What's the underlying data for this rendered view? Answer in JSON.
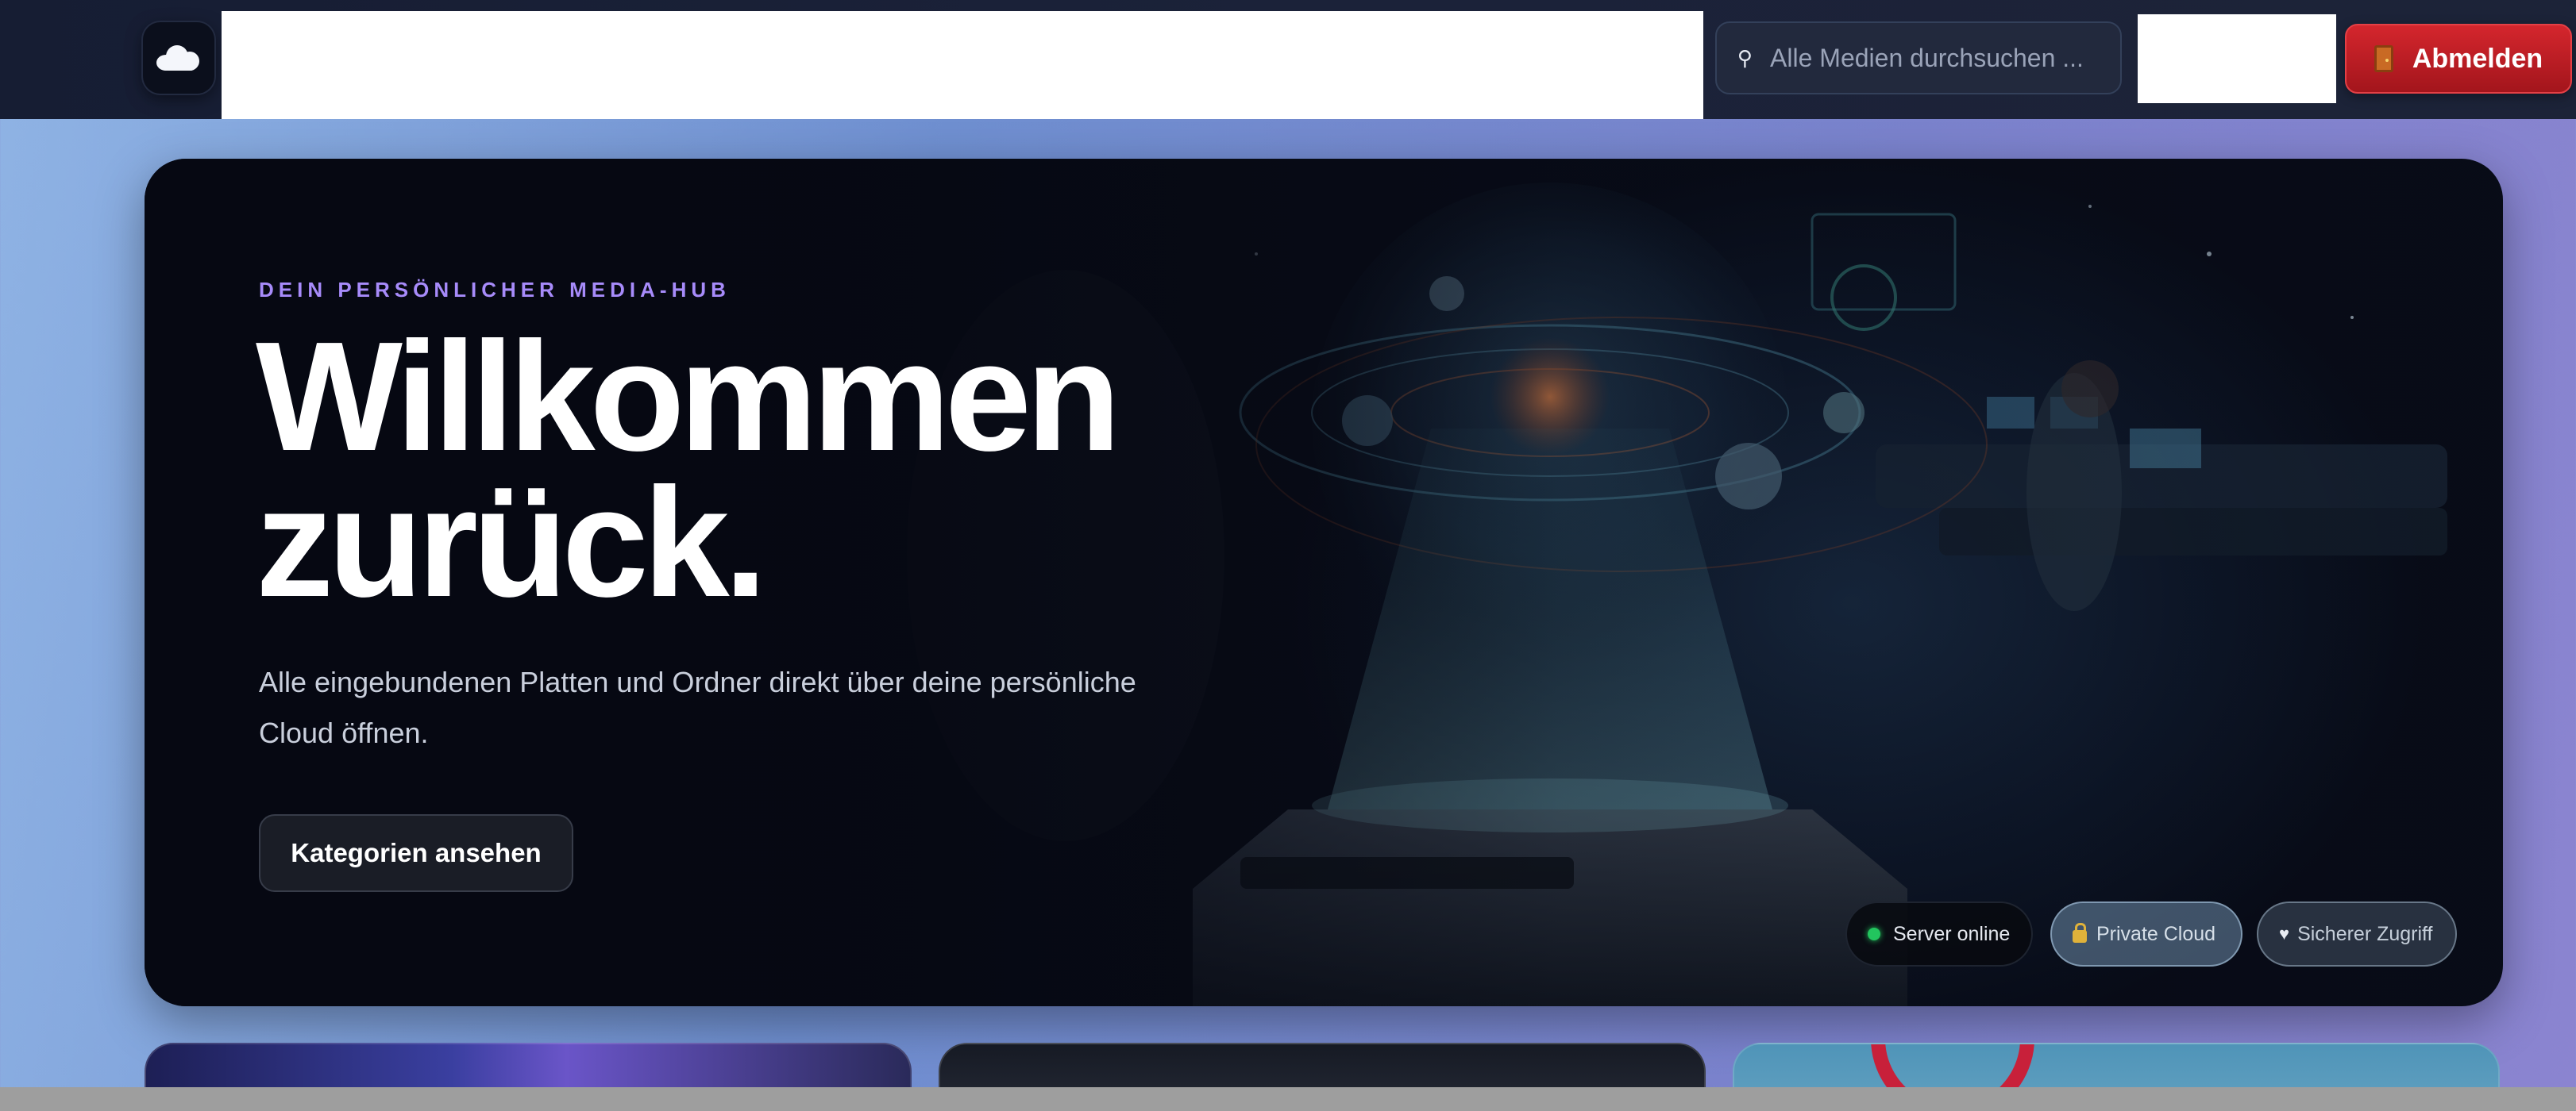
{
  "header": {
    "search_placeholder": "Alle Medien durchsuchen ...",
    "logout_label": "Abmelden"
  },
  "hero": {
    "eyebrow": "DEIN PERSÖNLICHER MEDIA-HUB",
    "title_line1": "Willkommen",
    "title_line2": "zurück.",
    "subtitle": "Alle eingebundenen Platten und Ordner direkt über deine persönliche Cloud öffnen.",
    "cta_label": "Kategorien ansehen",
    "chips": [
      {
        "label": "Server online",
        "icon": "status-dot-icon",
        "color": "#22c55e"
      },
      {
        "label": "Private Cloud",
        "icon": "lock-icon"
      },
      {
        "label": "Sicherer Zugriff",
        "icon": "heart-icon"
      }
    ]
  },
  "colors": {
    "accent": "#a78bfa",
    "logout": "#c81e26",
    "online": "#22c55e"
  }
}
